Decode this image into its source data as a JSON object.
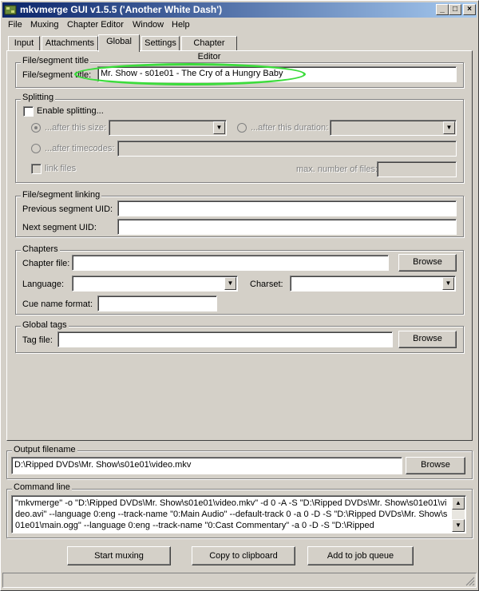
{
  "window": {
    "title": "mkvmerge GUI v1.5.5 ('Another White Dash')"
  },
  "titlebar_buttons": {
    "minimize": "_",
    "maximize": "□",
    "close": "×"
  },
  "menu": {
    "file": "File",
    "muxing": "Muxing",
    "chapter_editor": "Chapter Editor",
    "window": "Window",
    "help": "Help"
  },
  "tabs": {
    "input": "Input",
    "attachments": "Attachments",
    "global": "Global",
    "settings": "Settings",
    "chapter_editor": "Chapter Editor"
  },
  "segment_title": {
    "group": "File/segment title",
    "label": "File/segment title:",
    "value": "Mr. Show - s01e01 - The Cry of a Hungry Baby"
  },
  "splitting": {
    "group": "Splitting",
    "enable": "Enable splitting...",
    "after_size": "...after this size:",
    "after_duration": "...after this duration:",
    "after_timecodes": "...after timecodes:",
    "link_files": "link files",
    "max_files": "max. number of files:"
  },
  "linking": {
    "group": "File/segment linking",
    "prev_uid": "Previous segment UID:",
    "next_uid": "Next segment UID:"
  },
  "chapters": {
    "group": "Chapters",
    "chapter_file": "Chapter file:",
    "browse": "Browse",
    "language": "Language:",
    "charset": "Charset:",
    "cue_name_format": "Cue name format:"
  },
  "global_tags": {
    "group": "Global tags",
    "tag_file": "Tag file:",
    "browse": "Browse"
  },
  "output": {
    "group": "Output filename",
    "value": "D:\\Ripped DVDs\\Mr. Show\\s01e01\\video.mkv",
    "browse": "Browse"
  },
  "command": {
    "group": "Command line",
    "value": "\"mkvmerge\" -o \"D:\\Ripped DVDs\\Mr. Show\\s01e01\\video.mkv\"  -d 0 -A -S \"D:\\Ripped DVDs\\Mr. Show\\s01e01\\video.avi\" --language 0:eng --track-name \"0:Main Audio\" --default-track 0 -a 0 -D -S \"D:\\Ripped DVDs\\Mr. Show\\s01e01\\main.ogg\" --language 0:eng --track-name \"0:Cast Commentary\" -a 0 -D -S \"D:\\Ripped"
  },
  "scroll": {
    "up": "▲",
    "down": "▼"
  },
  "combo_arrow": "▼",
  "actions": {
    "start": "Start muxing",
    "copy": "Copy to clipboard",
    "add_job": "Add to job queue"
  },
  "colors": {
    "highlight": "#3bdc3b",
    "title_start": "#0a246a",
    "title_end": "#a6caf0"
  }
}
